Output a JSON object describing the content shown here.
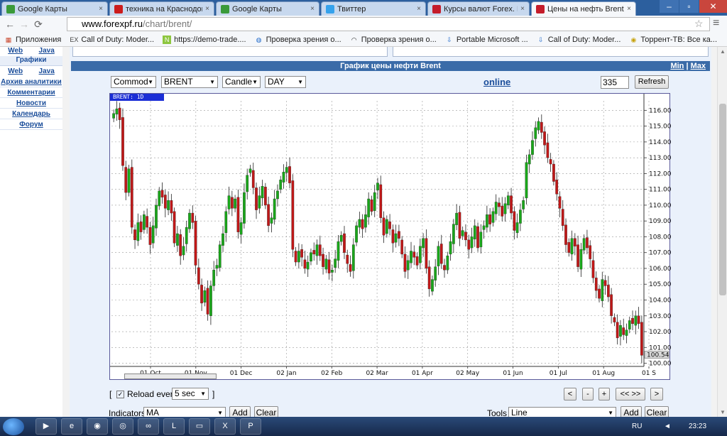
{
  "browser": {
    "tabs": [
      {
        "label": "Google Карты",
        "icon": "google-maps-icon",
        "active": false
      },
      {
        "label": "техника на Краснодона",
        "icon": "youtube-icon",
        "active": false
      },
      {
        "label": "Google Карты",
        "icon": "google-maps-icon",
        "active": false
      },
      {
        "label": "Твиттер",
        "icon": "twitter-icon",
        "active": false
      },
      {
        "label": "Курсы валют Forex. Кот",
        "icon": "forexpf-icon",
        "active": false
      },
      {
        "label": "Цены на нефть Brent",
        "icon": "forexpf-icon",
        "active": true
      }
    ],
    "url_domain": "www.forexpf.ru",
    "url_path": "/chart/brent/",
    "bookmarks": [
      {
        "label": "Приложения",
        "icon": "apps-icon"
      },
      {
        "label": "Call of Duty: Moder...",
        "icon": "ex-icon"
      },
      {
        "label": "https://demo-trade....",
        "icon": "n-icon"
      },
      {
        "label": "Проверка зрения о...",
        "icon": "eye-check-icon"
      },
      {
        "label": "Проверка зрения о...",
        "icon": "wifi-icon"
      },
      {
        "label": "Portable Microsoft ...",
        "icon": "download-icon"
      },
      {
        "label": "Call of Duty: Moder...",
        "icon": "download-icon"
      },
      {
        "label": "Торрент-ТВ: Все ка...",
        "icon": "eye-icon"
      }
    ]
  },
  "sidebar": {
    "row1": [
      "Web",
      "Java"
    ],
    "header1": "Графики",
    "row2": [
      "Web",
      "Java"
    ],
    "links": [
      "Архив аналитики",
      "Комментарии",
      "Новости",
      "Календарь",
      "Форум"
    ]
  },
  "page": {
    "title": "График цены нефти Brent",
    "min_label": "Min",
    "max_label": "Max",
    "selects": {
      "type": "Commod",
      "symbol": "BRENT",
      "style": "Candle",
      "period": "DAY"
    },
    "online_label": "online",
    "count": "335",
    "refresh_label": "Refresh",
    "symbol_tag": "BRENT: 1D",
    "reload_label": "Reload every",
    "reload_value": "5 sec",
    "nav_buttons": [
      "<",
      "-",
      "+",
      "<< >>",
      ">"
    ],
    "indicators_label": "Indicators",
    "indicators_value": "MA",
    "tools_label": "Tools",
    "tools_value": "Line",
    "add_label": "Add",
    "clear_label": "Clear"
  },
  "chart_data": {
    "type": "candlestick",
    "title": "BRENT: 1D",
    "last_price": "100.54",
    "ylim": [
      99.8,
      116.6
    ],
    "y_ticks": [
      "116.00",
      "115.00",
      "114.00",
      "113.00",
      "112.00",
      "111.00",
      "110.00",
      "109.00",
      "108.00",
      "107.00",
      "106.00",
      "105.00",
      "104.00",
      "103.00",
      "102.00",
      "101.00",
      "100.00"
    ],
    "x_ticks": [
      "01 Oct",
      "01 Nov",
      "01 Dec",
      "02 Jan",
      "02 Feb",
      "02 Mar",
      "01 Apr",
      "02 May",
      "01 Jun",
      "01 Jul",
      "01 Aug",
      "01 S"
    ],
    "close_series": [
      115.8,
      116.1,
      115.4,
      112.5,
      110.8,
      112.3,
      108.6,
      107.8,
      108.9,
      108.3,
      109.4,
      108.6,
      107.5,
      108.7,
      110.0,
      110.9,
      110.5,
      109.8,
      110.3,
      109.5,
      107.6,
      108.2,
      106.8,
      107.4,
      108.6,
      109.5,
      108.9,
      106.2,
      105.0,
      103.8,
      104.6,
      103.1,
      104.9,
      105.9,
      106.2,
      107.5,
      108.2,
      109.6,
      110.6,
      109.8,
      110.4,
      108.3,
      108.9,
      110.8,
      111.9,
      112.3,
      111.1,
      109.7,
      110.6,
      111.2,
      110.0,
      108.7,
      109.2,
      110.4,
      110.9,
      111.6,
      112.1,
      112.4,
      111.4,
      107.2,
      106.4,
      107.1,
      106.7,
      106.0,
      106.4,
      107.0,
      106.9,
      107.5,
      106.8,
      106.1,
      106.6,
      105.7,
      105.9,
      106.6,
      107.7,
      108.1,
      107.0,
      106.3,
      105.8,
      107.5,
      108.7,
      109.1,
      108.5,
      109.4,
      110.4,
      109.6,
      110.8,
      111.4,
      109.2,
      108.1,
      109.1,
      108.5,
      107.6,
      108.2,
      107.9,
      106.9,
      105.8,
      106.5,
      107.1,
      106.7,
      106.2,
      107.4,
      107.9,
      106.0,
      104.7,
      105.3,
      106.1,
      107.4,
      106.3,
      105.9,
      106.8,
      107.7,
      108.8,
      109.5,
      107.9,
      108.4,
      107.8,
      107.2,
      108.0,
      108.7,
      107.3,
      108.3,
      108.7,
      109.4,
      108.8,
      109.6,
      110.2,
      109.9,
      109.3,
      110.1,
      110.6,
      109.5,
      108.4,
      108.9,
      109.7,
      110.3,
      112.7,
      113.2,
      114.1,
      114.9,
      115.3,
      114.6,
      113.8,
      113.0,
      112.6,
      111.5,
      110.7,
      109.8,
      108.7,
      107.5,
      107.0,
      107.9,
      107.4,
      106.1,
      107.2,
      107.9,
      107.3,
      106.6,
      105.4,
      104.6,
      104.1,
      105.3,
      104.9,
      104.2,
      103.0,
      102.6,
      101.6,
      102.4,
      101.8,
      102.1,
      102.7,
      102.5,
      103.0,
      102.5,
      100.5
    ]
  }
}
